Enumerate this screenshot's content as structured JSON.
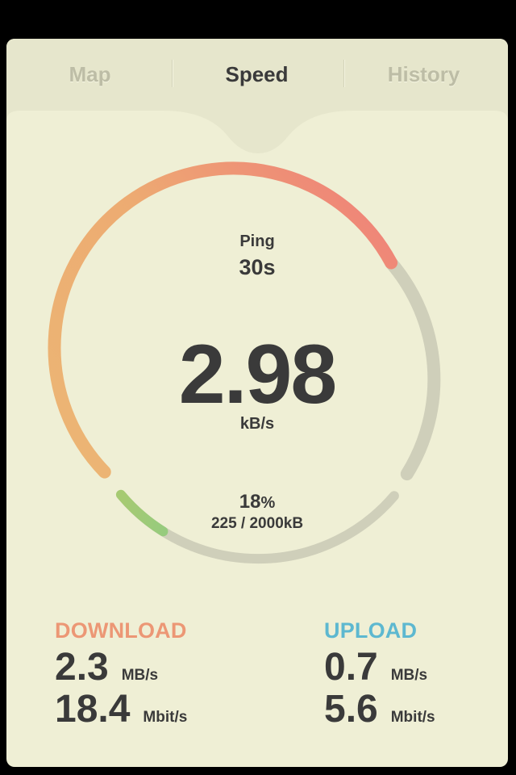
{
  "tabs": [
    {
      "label": "Map",
      "active": false
    },
    {
      "label": "Speed",
      "active": true
    },
    {
      "label": "History",
      "active": false
    }
  ],
  "gauge": {
    "ping_label": "Ping",
    "ping_value": "30s",
    "speed_value": "2.98",
    "speed_unit": "kB/s",
    "progress_percent": "18",
    "progress_percent_sign": "%",
    "progress_bytes": "225 / 2000kB",
    "progress_fraction": 0.18,
    "colors": {
      "speed_start": "#ecb674",
      "speed_end": "#ef8478",
      "progress_start": "#a6ca72",
      "progress_end": "#5fcfa8",
      "track": "#cfcfba"
    }
  },
  "download": {
    "title": "DOWNLOAD",
    "color": "#ec9775",
    "rate_value": "2.3",
    "rate_unit": "MB/s",
    "bits_value": "18.4",
    "bits_unit": "Mbit/s"
  },
  "upload": {
    "title": "UPLOAD",
    "color": "#5db8d0",
    "rate_value": "0.7",
    "rate_unit": "MB/s",
    "bits_value": "5.6",
    "bits_unit": "Mbit/s"
  }
}
